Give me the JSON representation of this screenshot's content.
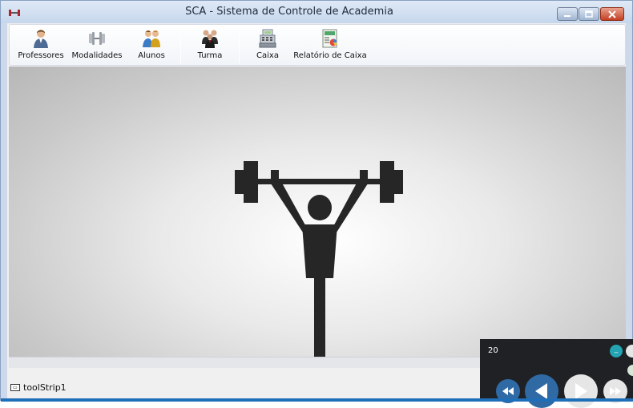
{
  "window": {
    "title": "SCA - Sistema de Controle de Academia",
    "app_icon": "dumbbell-icon",
    "controls": [
      "minimize",
      "maximize",
      "close"
    ]
  },
  "toolbar": {
    "items": [
      {
        "label": "Professores",
        "icon": "teacher-icon"
      },
      {
        "label": "Modalidades",
        "icon": "dumbbell-icon"
      },
      {
        "label": "Alunos",
        "icon": "students-icon"
      },
      {
        "label": "Turma",
        "icon": "class-group-icon"
      },
      {
        "label": "Caixa",
        "icon": "cash-register-icon"
      },
      {
        "label": "Relatório de Caixa",
        "icon": "report-icon"
      }
    ]
  },
  "main": {
    "background_image": "weightlifter-icon"
  },
  "statusbar": {
    "label": "toolStrip1"
  },
  "media_panel": {
    "count": "20",
    "accent": "#2f6aa4"
  }
}
